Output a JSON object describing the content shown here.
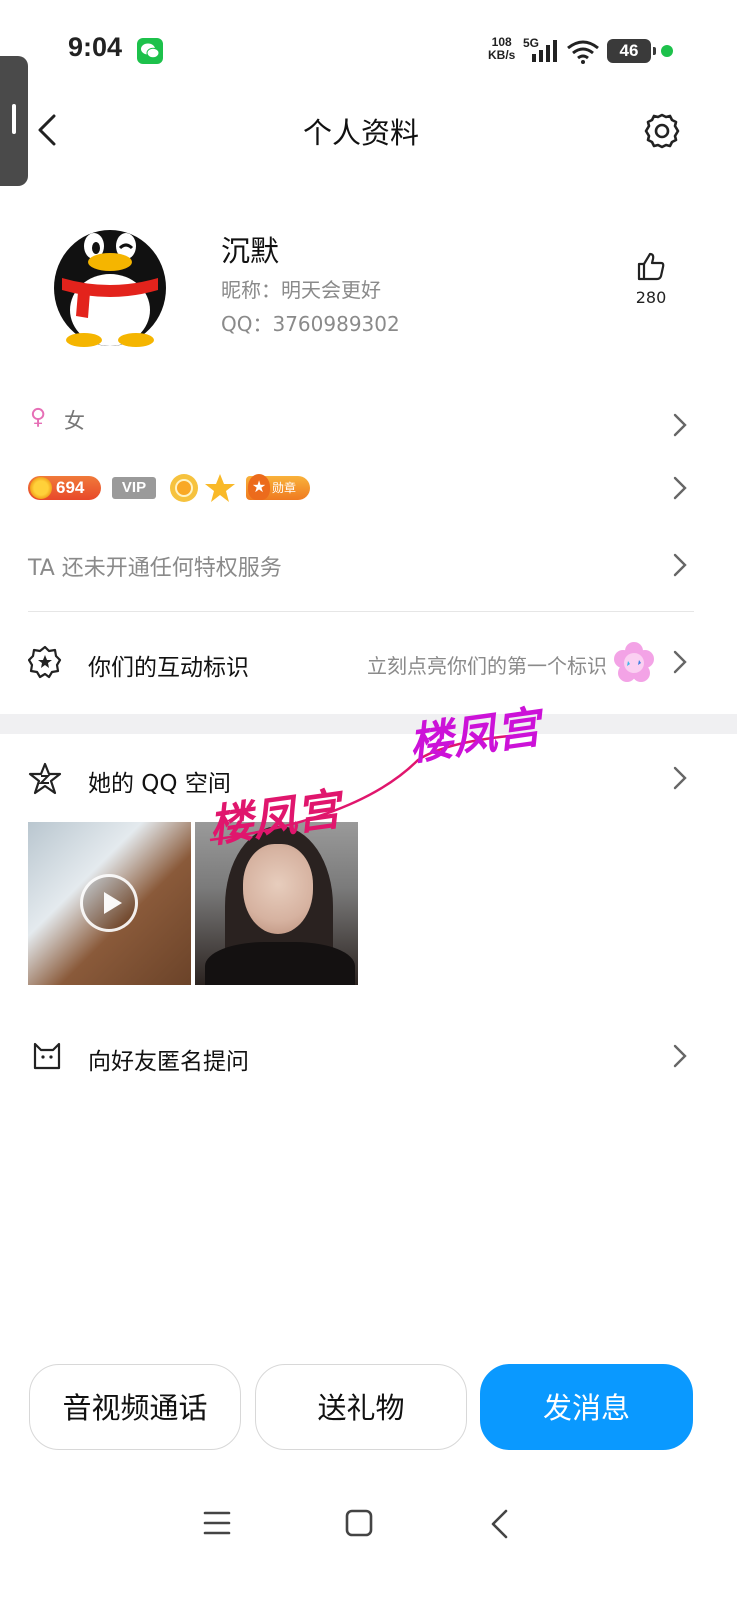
{
  "status_bar": {
    "time": "9:04",
    "net_speed_value": "108",
    "net_speed_unit": "KB/s",
    "net_type": "5G",
    "battery": "46",
    "signal_icon": "signal-bars-icon",
    "wifi_icon": "wifi-icon"
  },
  "header": {
    "title": "个人资料",
    "back_icon": "chevron-left-icon",
    "settings_icon": "gear-icon"
  },
  "profile": {
    "name": "沉默",
    "nickname": "昵称：明天会更好",
    "qq": "QQ：3760989302",
    "likes": "280"
  },
  "gender": {
    "symbol": "♀",
    "label": "女"
  },
  "badges": {
    "level": "694",
    "vip": "VIP",
    "medal": "勋章"
  },
  "privilege": {
    "text": "TA 还未开通任何特权服务"
  },
  "interaction": {
    "label": "你们的互动标识",
    "hint": "立刻点亮你们的第一个标识"
  },
  "qzone": {
    "label": "她的 QQ 空间"
  },
  "watermarks": {
    "text_1": "楼凤宫",
    "text_2": "楼凤宫"
  },
  "ask": {
    "label": "向好友匿名提问"
  },
  "actions": {
    "call": "音视频通话",
    "gift": "送礼物",
    "message": "发消息"
  },
  "colors": {
    "accent": "#0a99ff",
    "gender_pink": "#e66fb6",
    "wechat_green": "#1dc14b"
  }
}
